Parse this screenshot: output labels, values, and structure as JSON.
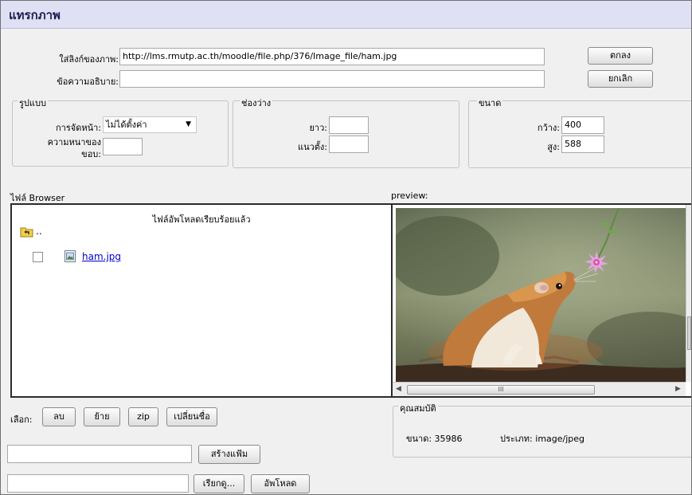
{
  "title": "แทรกภาพ",
  "image_url_label": "ใส่ลิงก์ของภาพ:",
  "image_url_value": "http://lms.rmutp.ac.th/moodle/file.php/376/Image_file/ham.jpg",
  "alt_label": "ข้อความอธิบาย:",
  "alt_value": "",
  "ok_label": "ตกลง",
  "cancel_label": "ยกเลิก",
  "layout": {
    "legend": "รูปแบบ",
    "align_label": "การจัดหน้า:",
    "align_value": "ไม่ได้ตั้งค่า",
    "border_label_line1": "ความหนาของ",
    "border_label_line2": "ขอบ:",
    "border_value": ""
  },
  "spacing": {
    "legend": "ช่องว่าง",
    "horizontal_label": "ยาว:",
    "horizontal_value": "",
    "vertical_label": "แนวตั้ง:",
    "vertical_value": ""
  },
  "size": {
    "legend": "ขนาด",
    "width_label": "กว้าง:",
    "width_value": "400",
    "height_label": "สูง:",
    "height_value": "588"
  },
  "browser": {
    "label": "ไฟล์ Browser",
    "status": "ไฟล์อัพโหลดเรียบร้อยแล้ว",
    "parent": "..",
    "file_name": "ham.jpg"
  },
  "preview": {
    "label": "preview:",
    "scroll_grip": "III"
  },
  "properties": {
    "legend": "คุณสมบัติ",
    "size_text": "ขนาด: 35986",
    "type_text": "ประเภท: image/jpeg"
  },
  "actions": {
    "select_label": "เลือก:",
    "delete_label": "ลบ",
    "move_label": "ย้าย",
    "zip_label": "zip",
    "rename_label": "เปลี่ยนชื่อ",
    "create_folder_value": "",
    "create_folder_label": "สร้างแฟ้ม",
    "upload_path_value": "",
    "browse_label": "เรียกดู...",
    "upload_label": "อัพโหลด"
  }
}
